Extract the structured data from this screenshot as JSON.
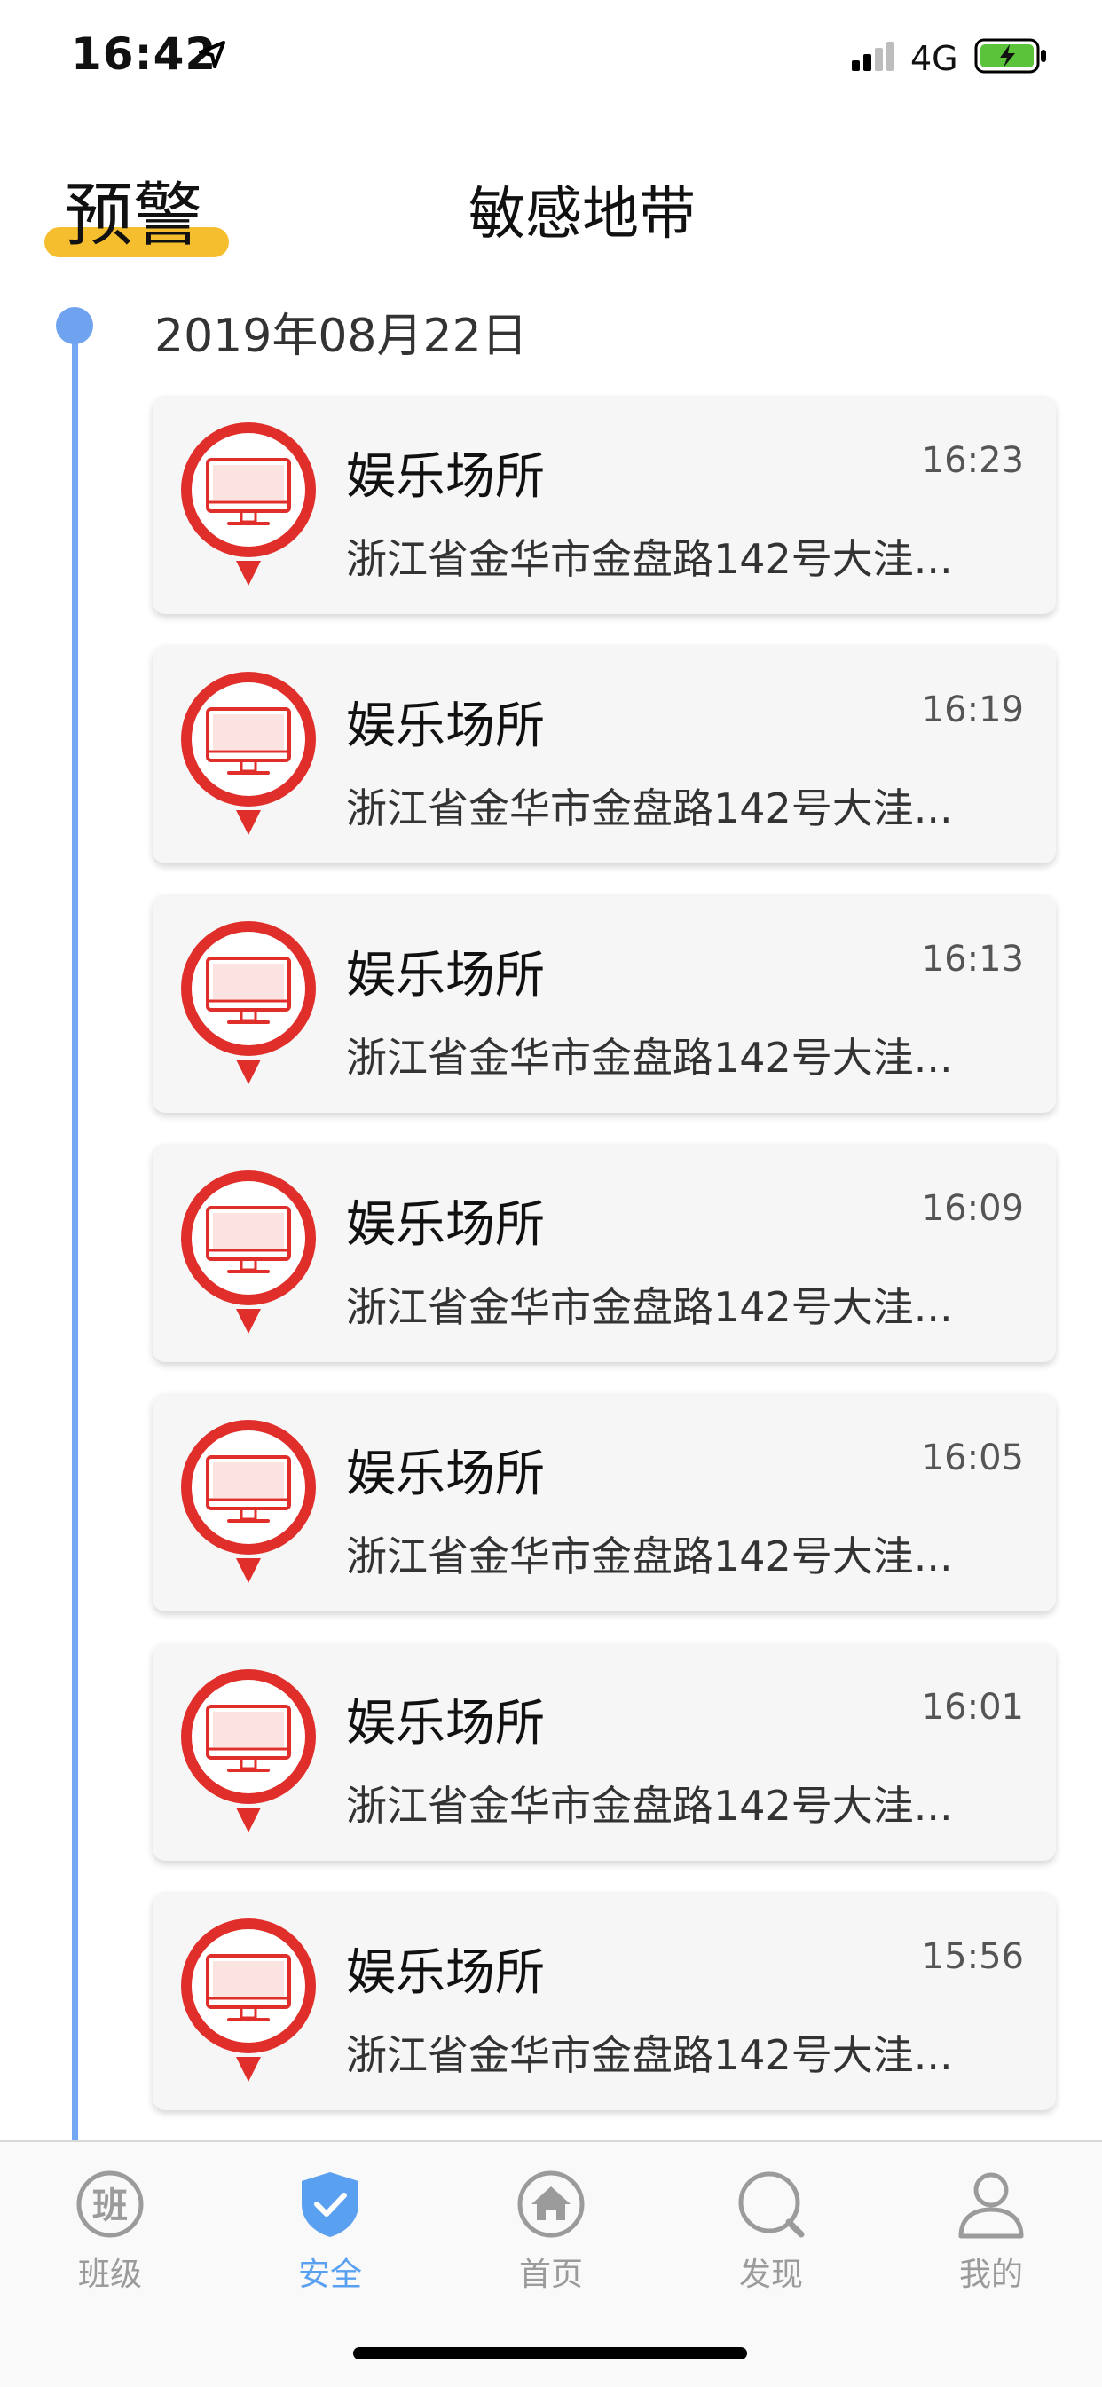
{
  "status_bar": {
    "time": "16:42",
    "network": "4G"
  },
  "top_tabs": {
    "active": "预警",
    "inactive": "敏感地带"
  },
  "timeline": {
    "date": "2019年08月22日",
    "entries": [
      {
        "title": "娱乐场所",
        "time": "16:23",
        "address": "浙江省金华市金盘路142号大洼..."
      },
      {
        "title": "娱乐场所",
        "time": "16:19",
        "address": "浙江省金华市金盘路142号大洼..."
      },
      {
        "title": "娱乐场所",
        "time": "16:13",
        "address": "浙江省金华市金盘路142号大洼..."
      },
      {
        "title": "娱乐场所",
        "time": "16:09",
        "address": "浙江省金华市金盘路142号大洼..."
      },
      {
        "title": "娱乐场所",
        "time": "16:05",
        "address": "浙江省金华市金盘路142号大洼..."
      },
      {
        "title": "娱乐场所",
        "time": "16:01",
        "address": "浙江省金华市金盘路142号大洼..."
      },
      {
        "title": "娱乐场所",
        "time": "15:56",
        "address": "浙江省金华市金盘路142号大洼..."
      }
    ]
  },
  "bottom_nav": {
    "items": [
      {
        "label": "班级",
        "icon": "class-icon",
        "glyph": "班"
      },
      {
        "label": "安全",
        "icon": "shield-check-icon"
      },
      {
        "label": "首页",
        "icon": "home-icon"
      },
      {
        "label": "发现",
        "icon": "discover-icon"
      },
      {
        "label": "我的",
        "icon": "profile-icon"
      }
    ],
    "active_index": 1
  },
  "colors": {
    "accent": "#5aa0f0",
    "tab_underline": "#f5be2e",
    "marker_red": "#e02f2a",
    "timeline": "#74a7f1",
    "battery": "#5ac33a"
  }
}
